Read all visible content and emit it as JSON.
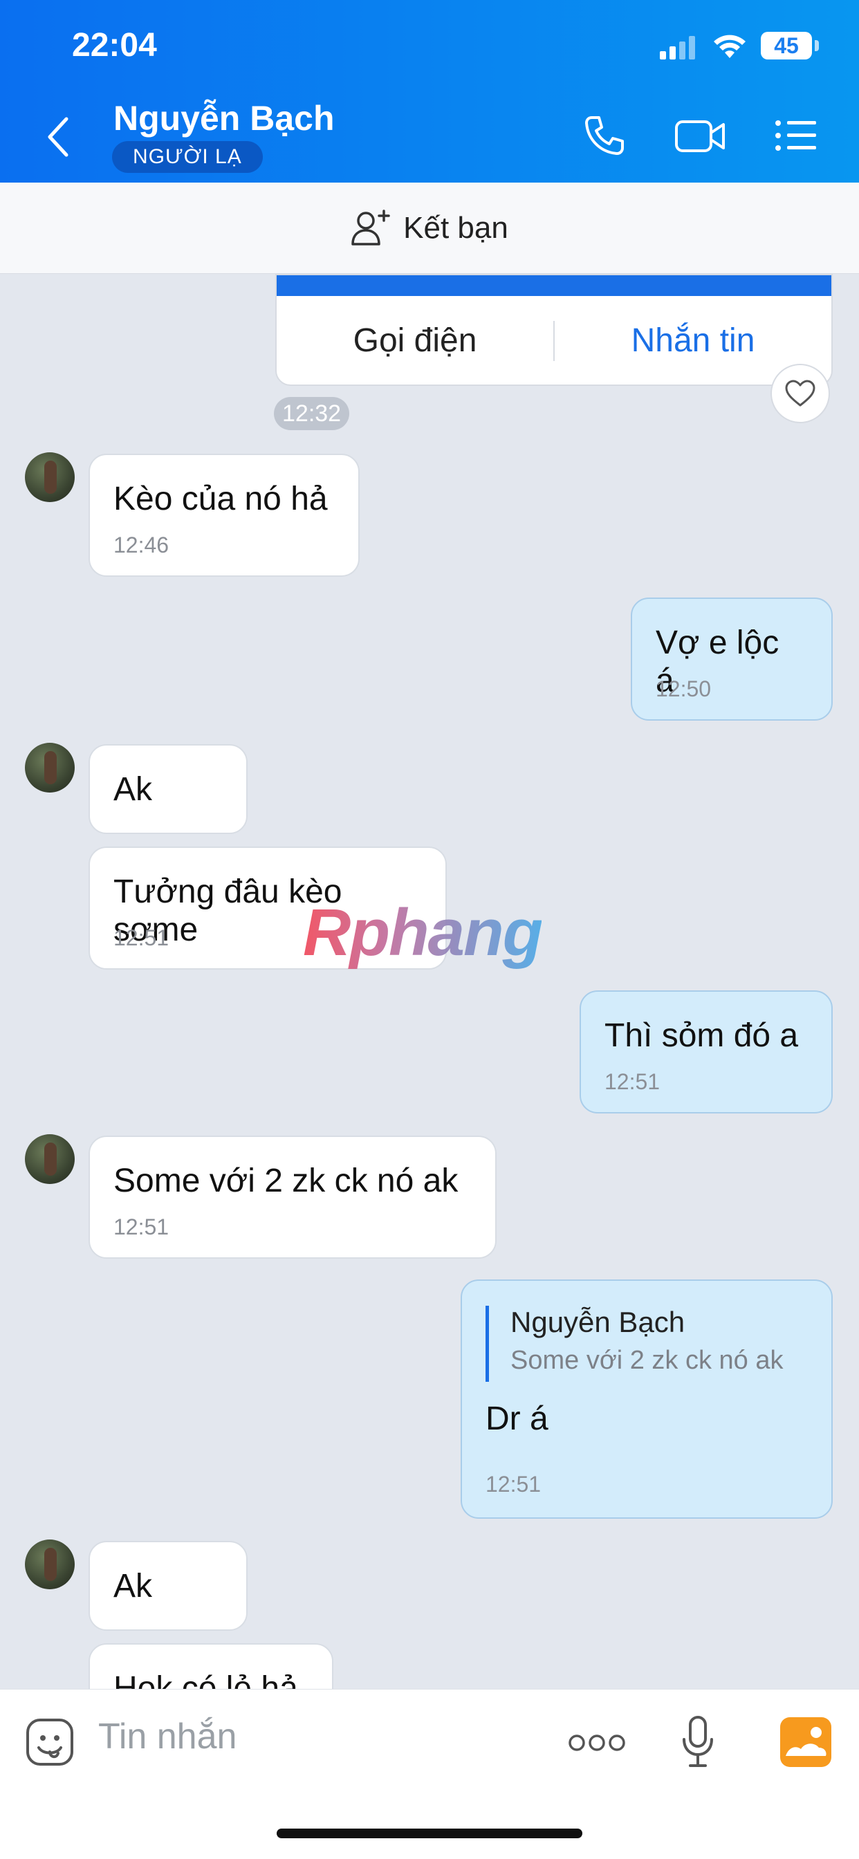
{
  "status": {
    "time": "22:04",
    "battery": "45"
  },
  "header": {
    "title": "Nguyễn Bạch",
    "badge": "NGƯỜI LẠ"
  },
  "friend_bar": {
    "label": "Kết bạn"
  },
  "call_card": {
    "left_label": "Gọi điện",
    "right_label": "Nhắn tin",
    "time": "12:32"
  },
  "messages": [
    {
      "dir": "in",
      "text": "Kèo của nó hả",
      "time": "12:46"
    },
    {
      "dir": "out",
      "text": "Vợ e lộc á",
      "time": "12:50"
    },
    {
      "dir": "in",
      "text": "Ak",
      "time": ""
    },
    {
      "dir": "in",
      "text": "Tưởng đâu kèo sơme",
      "time": "12:51"
    },
    {
      "dir": "out",
      "text": "Thì sỏm đó a",
      "time": "12:51"
    },
    {
      "dir": "in",
      "text": "Some với 2 zk ck nó ak",
      "time": "12:51"
    },
    {
      "dir": "out",
      "quote_name": "Nguyễn Bạch",
      "quote_text": "Some với 2 zk ck nó ak",
      "text": "Dr á",
      "time": "12:51"
    },
    {
      "dir": "in",
      "text": "Ak",
      "time": ""
    },
    {
      "dir": "in",
      "text": "Hok có lẻ hả",
      "time": ""
    }
  ],
  "watermark": "Rphang",
  "composer": {
    "placeholder": "Tin nhắn"
  },
  "colors": {
    "header_blue": "#0a6ff0",
    "accent_blue": "#1a6fe6",
    "outgoing_bubble": "#d3ecfb"
  }
}
